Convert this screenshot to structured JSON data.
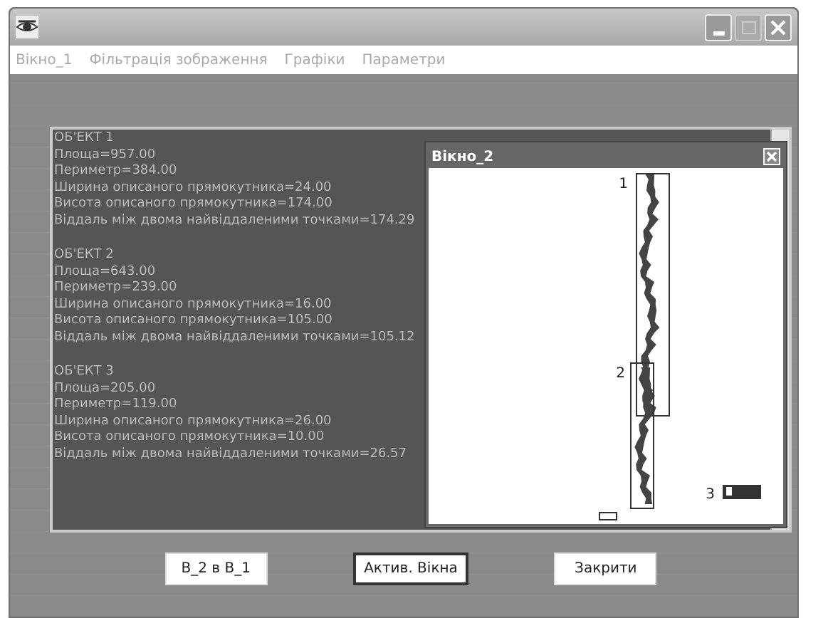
{
  "menu": [
    "Вікно_1",
    "Фільтрація зображення",
    "Графіки",
    "Параметри"
  ],
  "objects": [
    {
      "header": "ОБ'ЕКТ 1",
      "lines": [
        "Площа=957.00",
        "Периметр=384.00",
        "Ширина описаного прямокутника=24.00",
        "Висота описаного прямокутника=174.00",
        "Віддаль між двома найвіддаленими точками=174.29"
      ]
    },
    {
      "header": "ОБ'ЕКТ 2",
      "lines": [
        "Площа=643.00",
        "Периметр=239.00",
        "Ширина описаного прямокутника=16.00",
        "Висота описаного прямокутника=105.00",
        "Віддаль між двома найвіддаленими точками=105.12"
      ]
    },
    {
      "header": "ОБ'ЕКТ 3",
      "lines": [
        "Площа=205.00",
        "Периметр=119.00",
        "Ширина описаного прямокутника=26.00",
        "Висота описаного прямокутника=10.00",
        "Віддаль між двома найвіддаленими точками=26.57"
      ]
    }
  ],
  "child_window": {
    "title": "Вікно_2",
    "labels": [
      "1",
      "2",
      "3"
    ]
  },
  "buttons": [
    {
      "label": "В_2 в В_1",
      "focused": false
    },
    {
      "label": "Актив. Вікна",
      "focused": true
    },
    {
      "label": "Закрити",
      "focused": false
    }
  ]
}
